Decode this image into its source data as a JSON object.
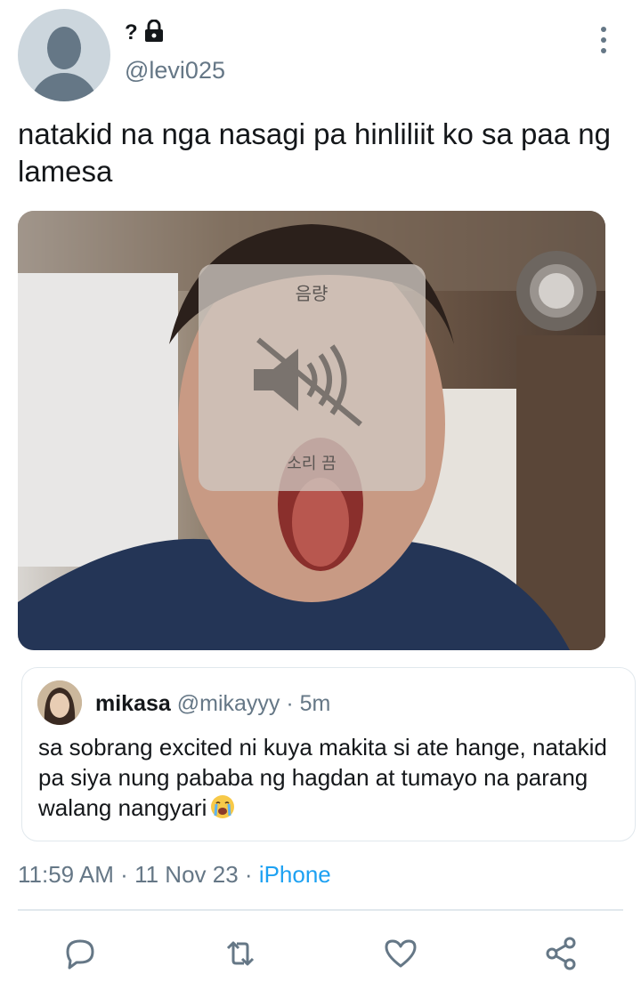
{
  "author": {
    "display_name": "?",
    "handle": "@levi025",
    "protected_icon": "lock-icon",
    "avatar_icon": "default-avatar-icon"
  },
  "tweet": {
    "text": "natakid na nga nasagi pa hinliliit ko sa paa ng lamesa"
  },
  "media": {
    "overlay_title": "음량",
    "overlay_subtitle": "소리 끔",
    "overlay_icon": "speaker-muted-icon"
  },
  "quoted_tweet": {
    "display_name": "mikasa",
    "handle": "@mikayyy",
    "separator": "·",
    "time": "5m",
    "text": "sa sobrang excited ni kuya makita si ate hange, natakid pa siya nung pababa ng hagdan at tumayo na parang walang nangyari",
    "emoji": "crying-face-icon"
  },
  "meta": {
    "time": "11:59 AM",
    "sep1": "·",
    "date": "11 Nov 23",
    "sep2": "·",
    "source": "iPhone"
  },
  "actions": [
    "reply-icon",
    "retweet-icon",
    "like-icon",
    "share-icon"
  ],
  "colors": {
    "accent": "#1da1f2",
    "secondary_text": "#657786",
    "border": "#e1e8ed"
  }
}
